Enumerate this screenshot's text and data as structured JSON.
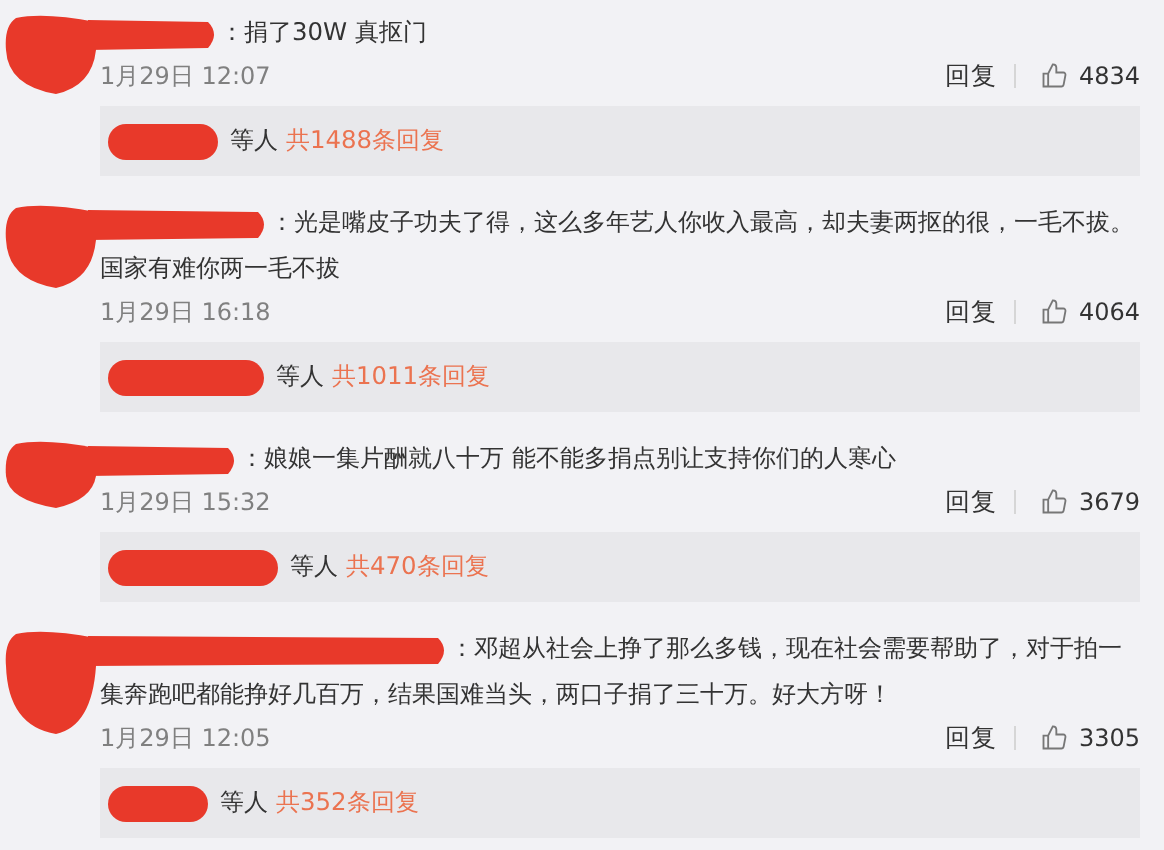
{
  "comments": [
    {
      "lines": [
        "：捐了30W 真抠门"
      ],
      "time": "1月29日 12:07",
      "reply": "回复",
      "likes": "4834",
      "thread": {
        "prefix": "等人",
        "link": "共1488条回复"
      }
    },
    {
      "lines": [
        "：光是嘴皮子功夫了得，这么多年艺人你收入最高，却夫妻两抠的很，一毛不拔。",
        "国家有难你两一毛不拔"
      ],
      "time": "1月29日 16:18",
      "reply": "回复",
      "likes": "4064",
      "thread": {
        "prefix": "等人",
        "link": "共1011条回复"
      }
    },
    {
      "lines": [
        "：娘娘一集片酬就八十万 能不能多捐点别让支持你们的人寒心"
      ],
      "time": "1月29日 15:32",
      "reply": "回复",
      "likes": "3679",
      "thread": {
        "prefix": "等人",
        "link": "共470条回复"
      }
    },
    {
      "lines": [
        "：邓超从社会上挣了那么多钱，现在社会需要帮助了，对于拍一",
        "集奔跑吧都能挣好几百万，结果国难当头，两口子捐了三十万。好大方呀！"
      ],
      "time": "1月29日 12:05",
      "reply": "回复",
      "likes": "3305",
      "thread": {
        "prefix": "等人",
        "link": "共352条回复"
      }
    }
  ]
}
